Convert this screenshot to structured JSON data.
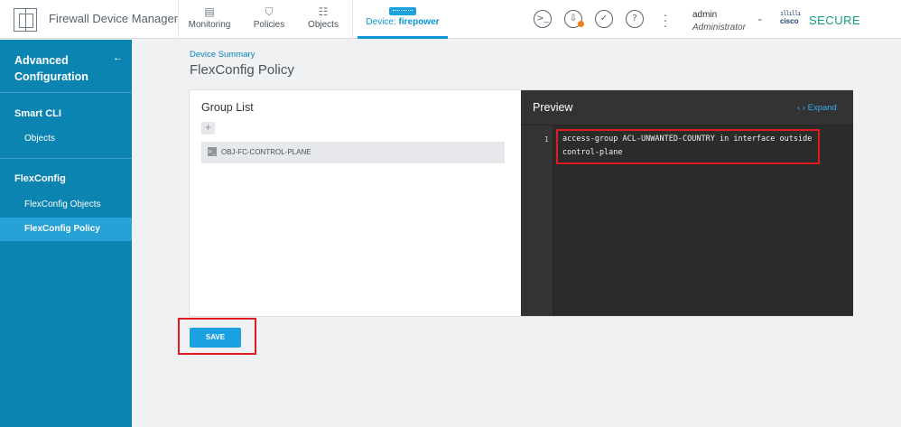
{
  "app": {
    "title": "Firewall Device Manager",
    "brand_colors": {
      "primary": "#0c84b2",
      "accent": "#1ba1e2",
      "secure": "#0fa07d",
      "highlight": "#e01b22"
    }
  },
  "nav": {
    "tabs": [
      {
        "label": "Monitoring",
        "icon": "monitoring-icon"
      },
      {
        "label": "Policies",
        "icon": "policies-icon"
      },
      {
        "label": "Objects",
        "icon": "objects-icon"
      }
    ],
    "device": {
      "prefix": "Device: ",
      "name": "firepower"
    }
  },
  "header_icons": [
    "cli-console-icon",
    "deploy-icon",
    "api-explorer-icon",
    "help-icon",
    "more-options-icon"
  ],
  "user": {
    "name": "admin",
    "role": "Administrator"
  },
  "vendor": {
    "name": "cisco",
    "product": "SECURE"
  },
  "sidebar": {
    "heading_line1": "Advanced",
    "heading_line2": "Configuration",
    "sections": [
      {
        "title": "Smart CLI",
        "items": [
          {
            "label": "Objects",
            "active": false
          }
        ]
      },
      {
        "title": "FlexConfig",
        "items": [
          {
            "label": "FlexConfig Objects",
            "active": false
          },
          {
            "label": "FlexConfig Policy",
            "active": true
          }
        ]
      }
    ]
  },
  "page": {
    "breadcrumb": "Device Summary",
    "title": "FlexConfig Policy"
  },
  "group_list": {
    "title": "Group List",
    "add_label": "+",
    "items": [
      {
        "label": "OBJ-FC-CONTROL-PLANE",
        "icon": "terminal-icon"
      }
    ]
  },
  "preview": {
    "title": "Preview",
    "expand_label": "Expand",
    "line_number": "1",
    "code_lines": [
      "access-group ACL-UNWANTED-COUNTRY in interface outside",
      "control-plane"
    ]
  },
  "actions": {
    "save_label": "SAVE"
  }
}
